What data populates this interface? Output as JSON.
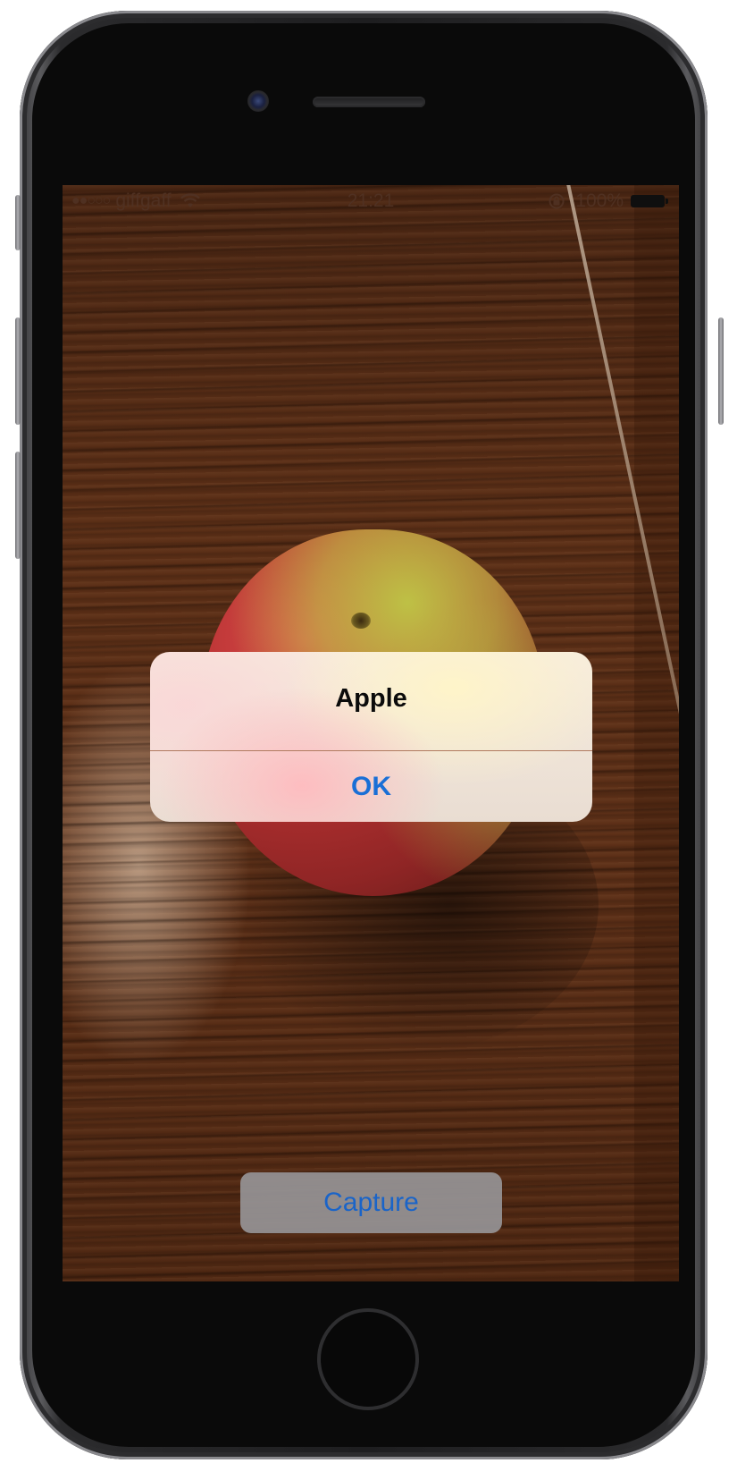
{
  "status_bar": {
    "signal": "●●○○○",
    "carrier": "giffgaff",
    "time": "21:21",
    "battery": "100%",
    "wifi_icon": "wifi-icon",
    "lock_icon": "orientation-lock-icon",
    "battery_icon": "battery-icon"
  },
  "alert": {
    "title": "Apple",
    "ok_label": "OK"
  },
  "main": {
    "capture_label": "Capture"
  },
  "colors": {
    "accent": "#1a6fd6",
    "capture_button_bg": "#969496",
    "alert_title": "#0b0b0b"
  }
}
